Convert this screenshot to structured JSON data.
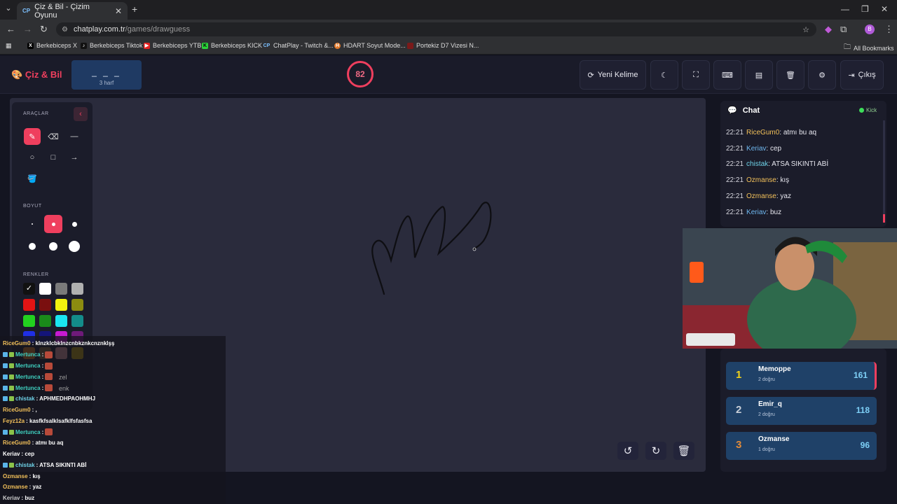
{
  "browser": {
    "tab_title": "Çiz & Bil - Çizim Oyunu",
    "tab_favicon": "CP",
    "url_host": "chatplay.com.tr",
    "url_path": "/games/drawguess",
    "profile_initial": "B",
    "bookmarks": [
      "Berkebiceps X",
      "Berkebiceps Tiktok",
      "Berkebiceps YTB",
      "Berkebiceps KICK",
      "ChatPlay - Twitch &...",
      "HDART Soyut Mode...",
      "Portekiz D7 Vizesi N..."
    ],
    "all_bookmarks": "All Bookmarks"
  },
  "header": {
    "logo": "Çiz & Bil",
    "word_mask": "_ _ _",
    "word_hint": "3 harf",
    "timer": "82",
    "new_word": "Yeni Kelime",
    "exit": "Çıkış"
  },
  "tools": {
    "section_tools": "ARAÇLAR",
    "section_size": "BOYUT",
    "section_colors": "RENKLER",
    "custom_hint": "zel",
    "custom_hint2": "enk",
    "palette": [
      "#111111",
      "#ffffff",
      "#7a7a7a",
      "#b0b0b0",
      "#e31414",
      "#7a0f0f",
      "#f2f20f",
      "#8c8c10",
      "#22d11f",
      "#1a8a1a",
      "#1ae6f0",
      "#138c8a",
      "#1f2fe6",
      "#14147a",
      "#c81ad1",
      "#6f1a7a",
      "#e07a1a",
      "#8a6a3a",
      "#e8a0a0",
      "#c9a600"
    ]
  },
  "overlay_chat": [
    {
      "user": "RiceGum0",
      "text": " : klnzklcbklnzcnbkznkcnznklşş",
      "color": "#f2c05a",
      "badges": 0
    },
    {
      "user": "Mertunca",
      "text": " :",
      "color": "#3fd1c0",
      "badges": 2,
      "emote": true
    },
    {
      "user": "Mertunca",
      "text": " :",
      "color": "#3fd1c0",
      "badges": 2,
      "emote": true
    },
    {
      "user": "Mertunca",
      "text": " :",
      "color": "#3fd1c0",
      "badges": 2,
      "emote": true
    },
    {
      "user": "Mertunca",
      "text": " :",
      "color": "#3fd1c0",
      "badges": 2,
      "emote": true
    },
    {
      "user": "chistak",
      "text": " : APHMEDHPAOHMHJ",
      "color": "#6fd3e8",
      "badges": 2
    },
    {
      "user": "RiceGum0",
      "text": " : ,",
      "color": "#f2c05a",
      "badges": 0
    },
    {
      "user": "Feyz12a",
      "text": " : kasfkfsalklsafklfsfasfsa",
      "color": "#f2c05a",
      "badges": 0
    },
    {
      "user": "Mertunca",
      "text": " :",
      "color": "#3fd1c0",
      "badges": 2,
      "emote": true
    },
    {
      "user": "RiceGum0",
      "text": " : atmı bu aq",
      "color": "#f2c05a",
      "badges": 0
    },
    {
      "user": "Keriav",
      "text": " : cep",
      "color": "#ffffff",
      "badges": 0
    },
    {
      "user": "chistak",
      "text": " : ATSA SIKINTI ABİ",
      "color": "#6fd3e8",
      "badges": 2
    },
    {
      "user": "Ozmanse",
      "text": " : kış",
      "color": "#f2c05a",
      "badges": 0
    },
    {
      "user": "Ozmanse",
      "text": " : yaz",
      "color": "#f2c05a",
      "badges": 0
    },
    {
      "user": "Keriav",
      "text": " : buz",
      "color": "#cccccc",
      "badges": 0
    }
  ],
  "chat": {
    "title": "Chat",
    "platform": "Kick",
    "messages": [
      {
        "time": "22:21",
        "user": "RiceGum0",
        "text": ": atmı bu aq",
        "color": "#f2c05a"
      },
      {
        "time": "22:21",
        "user": "Keriav",
        "text": ": cep",
        "color": "#6fb8f0"
      },
      {
        "time": "22:21",
        "user": "chistak",
        "text": ": ATSA SIKINTI ABİ",
        "color": "#6fd3e8"
      },
      {
        "time": "22:21",
        "user": "Ozmanse",
        "text": ": kış",
        "color": "#f2c05a"
      },
      {
        "time": "22:21",
        "user": "Ozmanse",
        "text": ": yaz",
        "color": "#f2c05a"
      },
      {
        "time": "22:21",
        "user": "Keriav",
        "text": ": buz",
        "color": "#6fb8f0"
      }
    ]
  },
  "leaderboard": [
    {
      "rank": "1",
      "name": "Memoppe",
      "sub": "2 doğru",
      "score": "161",
      "rank_color": "#f2d21a"
    },
    {
      "rank": "2",
      "name": "Emir_q",
      "sub": "2 doğru",
      "score": "118",
      "rank_color": "#c9cfd8"
    },
    {
      "rank": "3",
      "name": "Ozmanse",
      "sub": "1 doğru",
      "score": "96",
      "rank_color": "#e08a3a"
    }
  ]
}
